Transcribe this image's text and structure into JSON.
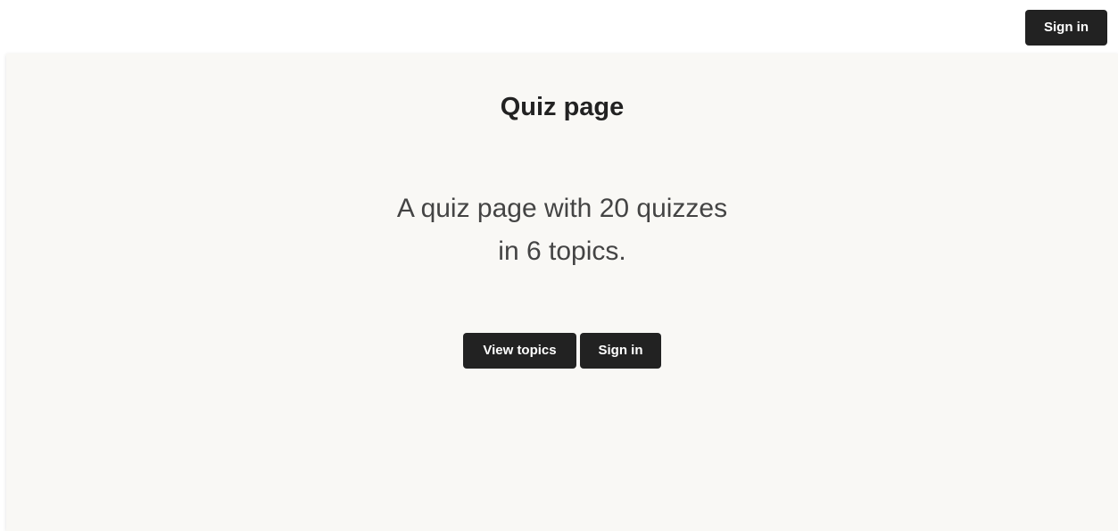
{
  "header": {
    "sign_in_label": "Sign in"
  },
  "main": {
    "title": "Quiz page",
    "description_line1": "A quiz page with 20 quizzes",
    "description_line2": "in 6 topics.",
    "view_topics_label": "View topics",
    "sign_in_label": "Sign in"
  },
  "colors": {
    "button_bg": "#222222",
    "button_text": "#ffffff",
    "page_bg": "#f9f8f5",
    "header_bg": "#ffffff"
  }
}
